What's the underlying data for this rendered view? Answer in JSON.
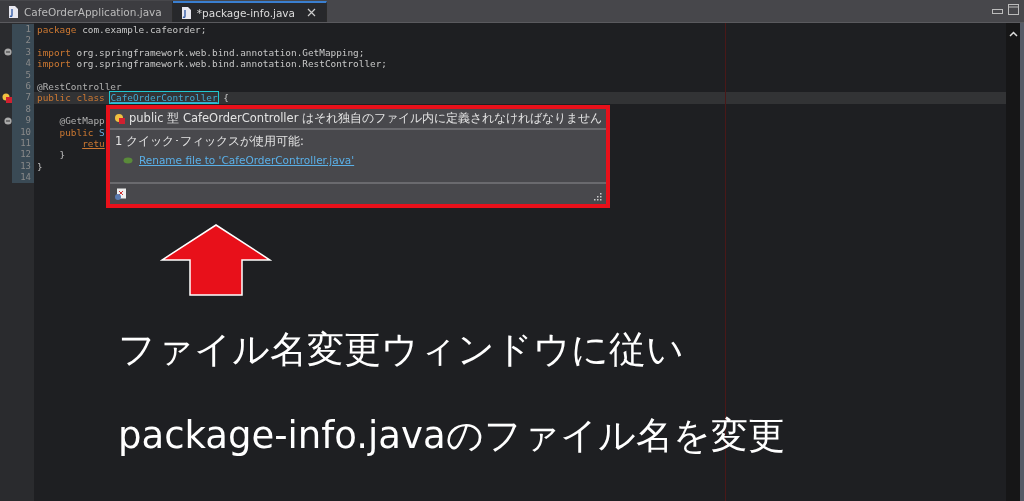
{
  "tabs": [
    {
      "label": "CafeOrderApplication.java",
      "selected": false
    },
    {
      "label": "*package-info.java",
      "selected": true
    }
  ],
  "code_lines": [
    {
      "number": "1",
      "current": false,
      "tokens": [
        {
          "text": "package",
          "kind": "keyword"
        },
        {
          "text": " com.example.cafeorder;",
          "kind": "plain"
        }
      ]
    },
    {
      "number": "2",
      "current": false
    },
    {
      "number": "3",
      "kind": "fold",
      "current": false,
      "tokens": [
        {
          "text": "import",
          "kind": "keyword"
        },
        {
          "text": " org.springframework.web.bind.annotation.GetMapping;",
          "kind": "plain"
        }
      ]
    },
    {
      "number": "4",
      "current": false,
      "tokens": [
        {
          "text": "import",
          "kind": "keyword"
        },
        {
          "text": " org.springframework.web.bind.annotation.RestController;",
          "kind": "plain"
        }
      ]
    },
    {
      "number": "5",
      "current": false
    },
    {
      "number": "6",
      "current": false,
      "tokens": [
        {
          "text": "@RestController",
          "kind": "annotation"
        }
      ]
    },
    {
      "number": "7",
      "kind": "error",
      "current": true,
      "tokens": [
        {
          "text": "public class",
          "kind": "keyword"
        },
        {
          "text": " CafeOrderController",
          "kind": "boxed"
        },
        {
          "text": " {",
          "kind": "plain"
        }
      ]
    },
    {
      "number": "8",
      "current": false
    },
    {
      "number": "9",
      "kind": "fold",
      "current": false,
      "tokens": [
        {
          "text": "    @GetMapp",
          "kind": "annotation"
        }
      ]
    },
    {
      "number": "10",
      "current": false,
      "tokens": [
        {
          "text": "    public",
          "kind": "keyword"
        },
        {
          "text": " S",
          "kind": "type"
        }
      ]
    },
    {
      "number": "11",
      "current": false,
      "tokens": [
        {
          "text": "        retu",
          "kind": "error_keyword"
        }
      ]
    },
    {
      "number": "12",
      "current": false,
      "tokens": [
        {
          "text": "    }",
          "kind": "plain"
        }
      ]
    },
    {
      "number": "13",
      "current": false,
      "tokens": [
        {
          "text": "}",
          "kind": "plain"
        }
      ]
    },
    {
      "number": "14",
      "current": false
    }
  ],
  "quick_fix_popup": {
    "title": "public 型 CafeOrderController はそれ独自のファイル内に定義されなければなりません",
    "count_text": "1 クイック･フィックスが使用可能:",
    "fixes": [
      {
        "label": "Rename file to 'CafeOrderController.java'"
      }
    ]
  },
  "caption": [
    "ファイル名変更ウィンドウに従い",
    "package-info.javaのファイル名を変更"
  ]
}
